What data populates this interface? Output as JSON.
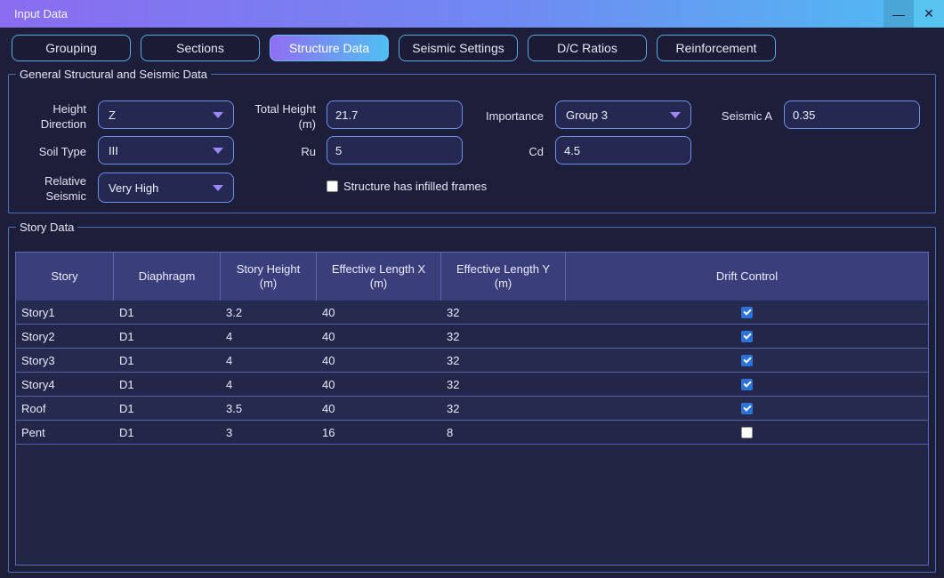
{
  "window": {
    "title": "Input Data",
    "minimize_glyph": "—",
    "close_glyph": "✕"
  },
  "tabs": [
    {
      "label": "Grouping",
      "active": false
    },
    {
      "label": "Sections",
      "active": false
    },
    {
      "label": "Structure Data",
      "active": true
    },
    {
      "label": "Seismic Settings",
      "active": false
    },
    {
      "label": "D/C Ratios",
      "active": false
    },
    {
      "label": "Reinforcement",
      "active": false
    }
  ],
  "general": {
    "legend": "General Structural and Seismic Data",
    "height_direction": {
      "label_1": "Height",
      "label_2": "Direction",
      "value": "Z"
    },
    "soil_type": {
      "label": "Soil Type",
      "value": "III"
    },
    "relative_seismic": {
      "label_1": "Relative",
      "label_2": "Seismic",
      "value": "Very High"
    },
    "total_height": {
      "label_1": "Total Height",
      "label_2": "(m)",
      "value": "21.7"
    },
    "ru": {
      "label": "Ru",
      "value": "5"
    },
    "infilled": {
      "label": "Structure has infilled frames",
      "checked": false
    },
    "importance": {
      "label": "Importance",
      "value": "Group 3"
    },
    "cd": {
      "label": "Cd",
      "value": "4.5"
    },
    "seismic_a": {
      "label": "Seismic A",
      "value": "0.35"
    }
  },
  "story": {
    "legend": "Story Data",
    "columns": [
      {
        "line1": "Story",
        "line2": ""
      },
      {
        "line1": "Diaphragm",
        "line2": ""
      },
      {
        "line1": "Story Height",
        "line2": "(m)"
      },
      {
        "line1": "Effective Length X",
        "line2": "(m)"
      },
      {
        "line1": "Effective Length Y",
        "line2": "(m)"
      },
      {
        "line1": "Drift Control",
        "line2": ""
      }
    ],
    "rows": [
      {
        "story": "Story1",
        "diaphragm": "D1",
        "height": "3.2",
        "lx": "40",
        "ly": "32",
        "drift": true
      },
      {
        "story": "Story2",
        "diaphragm": "D1",
        "height": "4",
        "lx": "40",
        "ly": "32",
        "drift": true
      },
      {
        "story": "Story3",
        "diaphragm": "D1",
        "height": "4",
        "lx": "40",
        "ly": "32",
        "drift": true
      },
      {
        "story": "Story4",
        "diaphragm": "D1",
        "height": "4",
        "lx": "40",
        "ly": "32",
        "drift": true
      },
      {
        "story": "Roof",
        "diaphragm": "D1",
        "height": "3.5",
        "lx": "40",
        "ly": "32",
        "drift": true
      },
      {
        "story": "Pent",
        "diaphragm": "D1",
        "height": "3",
        "lx": "16",
        "ly": "8",
        "drift": false
      }
    ]
  }
}
